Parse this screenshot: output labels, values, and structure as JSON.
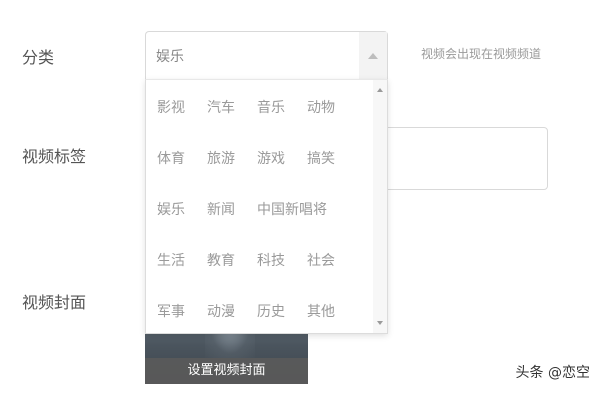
{
  "form": {
    "category_label": "分类",
    "tags_label": "视频标签",
    "cover_label": "视频封面",
    "category_hint": "视频会出现在视频频道"
  },
  "category_select": {
    "selected": "娱乐",
    "options": [
      [
        "影视",
        "汽车",
        "音乐",
        "动物"
      ],
      [
        "体育",
        "旅游",
        "游戏",
        "搞笑"
      ],
      [
        "娱乐",
        "新闻",
        "中国新唱将"
      ],
      [
        "生活",
        "教育",
        "科技",
        "社会"
      ],
      [
        "军事",
        "动漫",
        "历史",
        "其他"
      ]
    ]
  },
  "cover": {
    "button_label": "设置视频封面"
  },
  "watermark": "头条 @恋空"
}
